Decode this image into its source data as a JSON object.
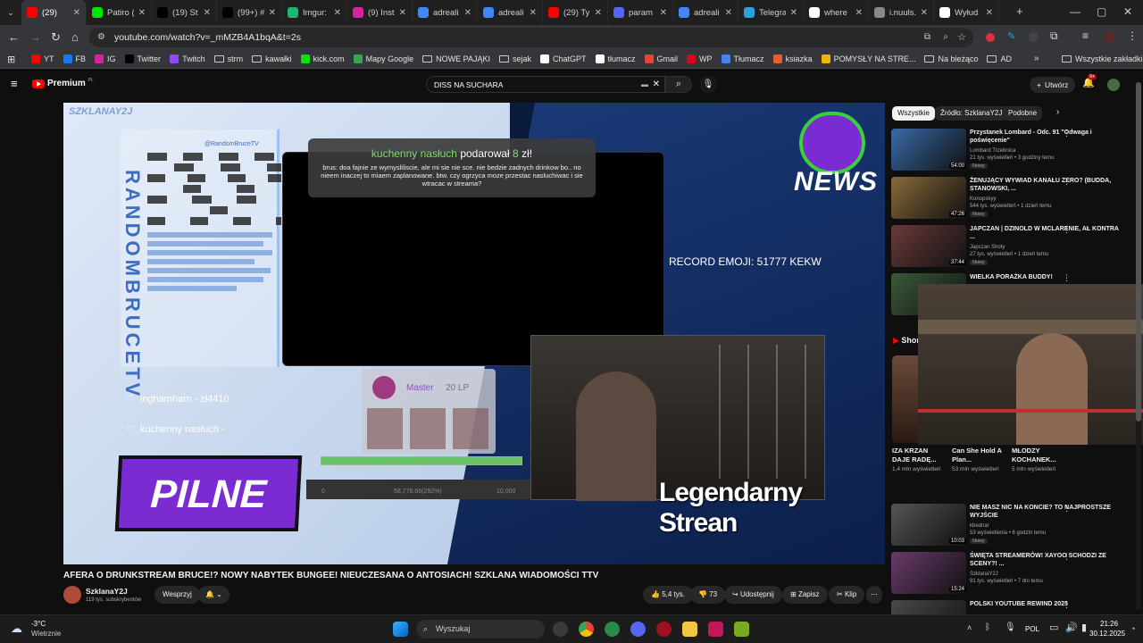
{
  "browser": {
    "tabs": [
      {
        "label": "(29)",
        "color": "#ff0000",
        "icon": "youtube-icon",
        "active": true
      },
      {
        "label": "Patiro (",
        "color": "#00e701",
        "icon": "kick-icon"
      },
      {
        "label": "(19) St",
        "color": "#000000",
        "icon": "x-icon"
      },
      {
        "label": "(99+) #",
        "color": "#010101",
        "icon": "tiktok-icon"
      },
      {
        "label": "Imgur:",
        "color": "#1bb76e",
        "icon": "imgur-icon"
      },
      {
        "label": "(9) Inst",
        "color": "#d6249f",
        "icon": "instagram-icon"
      },
      {
        "label": "adreali",
        "color": "#4285f4",
        "icon": "drive-icon"
      },
      {
        "label": "adreali",
        "color": "#4285f4",
        "icon": "drive-icon"
      },
      {
        "label": "(29) Ty",
        "color": "#ff0000",
        "icon": "youtube-icon"
      },
      {
        "label": "param",
        "color": "#5865f2",
        "icon": "link-icon"
      },
      {
        "label": "adreali",
        "color": "#4285f4",
        "icon": "drive-icon"
      },
      {
        "label": "Telegra",
        "color": "#2aa1da",
        "icon": "telegram-icon"
      },
      {
        "label": "where",
        "color": "#ffffff",
        "icon": "chatgpt-icon"
      },
      {
        "label": "i.nuuls.",
        "color": "#888888",
        "icon": "globe-icon"
      },
      {
        "label": "Wyłud",
        "color": "#ffffff",
        "icon": "wikipedia-icon"
      }
    ],
    "url": "youtube.com/watch?v=_mMZB4A1bqA&t=2s",
    "bookmarks": [
      {
        "label": "YT",
        "icon": "youtube-icon",
        "color": "#ff0000"
      },
      {
        "label": "FB",
        "icon": "facebook-icon",
        "color": "#1877f2"
      },
      {
        "label": "IG",
        "icon": "instagram-icon",
        "color": "#d6249f"
      },
      {
        "label": "Twitter",
        "icon": "x-icon",
        "color": "#000000"
      },
      {
        "label": "Twitch",
        "icon": "twitch-icon",
        "color": "#9146ff"
      },
      {
        "label": "strm",
        "icon": "folder-icon",
        "color": ""
      },
      {
        "label": "kawałki",
        "icon": "folder-icon",
        "color": ""
      },
      {
        "label": "kick.com",
        "icon": "kick-icon",
        "color": "#00e701"
      },
      {
        "label": "Mapy Google",
        "icon": "maps-icon",
        "color": "#34a853"
      },
      {
        "label": "NOWE PAJĄKI",
        "icon": "folder-icon",
        "color": ""
      },
      {
        "label": "sejak",
        "icon": "folder-icon",
        "color": ""
      },
      {
        "label": "ChatGPT",
        "icon": "chatgpt-icon",
        "color": "#ffffff"
      },
      {
        "label": "tłumacz",
        "icon": "chatgpt-icon",
        "color": "#ffffff"
      },
      {
        "label": "Gmail",
        "icon": "gmail-icon",
        "color": "#ea4335"
      },
      {
        "label": "WP",
        "icon": "wp-icon",
        "color": "#e0001b"
      },
      {
        "label": "Tłumacz",
        "icon": "translate-icon",
        "color": "#4285f4"
      },
      {
        "label": "ksiazka",
        "icon": "book-icon",
        "color": "#e85d2c"
      },
      {
        "label": "POMYSŁY NA STRE...",
        "icon": "bookmark-icon",
        "color": "#f4b400"
      },
      {
        "label": "Na bieżąco",
        "icon": "folder-icon",
        "color": ""
      },
      {
        "label": "AD",
        "icon": "folder-icon",
        "color": ""
      }
    ],
    "all_bookmarks": "Wszystkie zakładki"
  },
  "youtube": {
    "logo_text": "Premium",
    "logo_sup": "PL",
    "search_value": "DISS NA SUCHARA",
    "create_label": "Utwórz",
    "notif_count": "9+",
    "video": {
      "watermark": "SZKLANAY2J",
      "donation_name": "kuchenny nasłuch",
      "donation_mid": "podarował",
      "donation_amount": "8",
      "donation_currency": "zł!",
      "donation_msg": "brus: doa fajnie ze wymysliliscie, ale mi sie nie sce. nie bedzie zadnych drinkow bo.. no nieem inaczej to miaem zaplanowane. btw. czy ogrzyca moze przestac nasluchiwac i sie wtracac w streama?",
      "record_text": "RECORD EMOJI: 51777 KEKW",
      "news_logo": "NEWS",
      "pilne": "PILNE",
      "legendarny": "Legendarny Strean",
      "vertical_name": "RANDOMBRUCETV",
      "chat_user": "@RandomBruceTV",
      "master_label": "Master",
      "lp": "20 LP",
      "don1": "inghamham - zł4410",
      "don2": "kuchenny nasłuch -",
      "bar_left": "0",
      "bar_mid": "58,778.66(292%)",
      "bar_right": "10,000"
    },
    "title": "AFERA O DRUNKSTREAM BRUCE!? NOWY NABYTEK BUNGEE! NIEUCZESANA O ANTOSIACH! SZKLANA WIADOMOŚCI TTV",
    "channel": "SzklanaY2J",
    "subs": "119 tys. subskrybentów",
    "support_label": "Wesprzyj",
    "likes": "5,4 tys.",
    "dislikes": "73",
    "share_label": "Udostępnij",
    "save_label": "Zapisz",
    "clip_label": "Klip",
    "chips": [
      "Wszystkie",
      "Źródło: SzklanaY2J",
      "Podobne"
    ],
    "recommendations": [
      {
        "title": "Przystanek Lombard - Odc. 91 \"Odwaga i poświęcenie\"",
        "channel": "Lombard Trzebnica",
        "meta": "21 tys. wyświetleń • 3 godziny temu",
        "badge": "Nowy",
        "duration": "54:00",
        "color": "#3a6aa8"
      },
      {
        "title": "ŻENUJĄCY WYWIAD KANAŁU ZERO? (BUDDA, STANOWSKI, ...",
        "channel": "Konopskyy",
        "meta": "544 tys. wyświetleń • 1 dzień temu",
        "badge": "Nowy",
        "duration": "47:26",
        "color": "#8a6a3a"
      },
      {
        "title": "JAPCZAN | DZINOLD W MCLARENIE, AŁ KONTRA ...",
        "channel": "Japczan Shoty",
        "meta": "27 tys. wyświetleń • 1 dzień temu",
        "badge": "Nowy",
        "duration": "37:44",
        "color": "#6a3a3a"
      },
      {
        "title": "WIELKA PORAŻKA BUDDY!",
        "channel": "",
        "meta": "",
        "badge": "",
        "duration": "",
        "color": "#3a5a3a"
      }
    ],
    "shorts_label": "Shorts",
    "shorts": [
      {
        "title": "IZA KRZAN DAJE RADĘ...",
        "views": "1,4 mln wyświetleń"
      },
      {
        "title": "Can She Hold A Plan...",
        "views": "53 mln wyświetleń"
      },
      {
        "title": "MŁODZY KOCHANEK...",
        "views": "5 mln wyświetleń"
      }
    ],
    "recommendations2": [
      {
        "title": "NIE MASZ NIC NA KONCIE? TO NAJPROSTSZE WYJŚCIE",
        "channel": "kbednar",
        "meta": "53 wyświetlenia • 6 godzin temu",
        "badge": "Nowy",
        "duration": "10:03",
        "color": "#555555"
      },
      {
        "title": "ŚWIĘTA STREAMERÓW! XAYOO SCHODZI ZE SCENY?! ...",
        "channel": "SzklanaY2J",
        "meta": "91 tys. wyświetleń • 7 dni temu",
        "badge": "",
        "duration": "15:24",
        "color": "#6a3a6a"
      },
      {
        "title": "POLSKI YOUTUBE REWIND 2025",
        "channel": "",
        "meta": "",
        "badge": "",
        "duration": "",
        "color": "#4a4a4a"
      }
    ]
  },
  "taskbar": {
    "weather_temp": "-3°C",
    "weather_text": "Wietrznie",
    "search_placeholder": "Wyszukaj",
    "lang": "POL",
    "time": "21:26",
    "date": "30.12.2025"
  }
}
